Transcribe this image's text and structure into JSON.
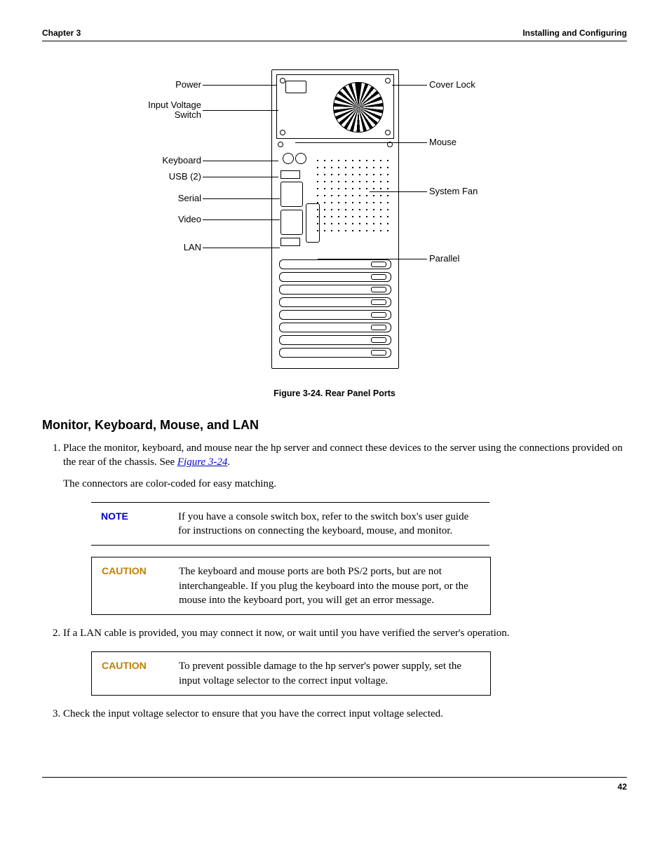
{
  "header": {
    "left": "Chapter 3",
    "right": "Installing and Configuring"
  },
  "figure": {
    "caption": "Figure 3-24.  Rear Panel Ports",
    "labels_left": {
      "power": "Power",
      "input_voltage": "Input Voltage\nSwitch",
      "keyboard": "Keyboard",
      "usb": "USB (2)",
      "serial": "Serial",
      "video": "Video",
      "lan": "LAN"
    },
    "labels_right": {
      "cover_lock": "Cover Lock",
      "mouse": "Mouse",
      "system_fan": "System Fan",
      "parallel": "Parallel"
    }
  },
  "section_heading": "Monitor, Keyboard, Mouse, and LAN",
  "steps": {
    "s1a": "Place the monitor, keyboard, and mouse near the hp server and connect these devices to the server using the connections provided on the rear of the chassis. See ",
    "s1_figref": "Figure 3-24",
    "s1b": ".",
    "s1_extra": "The connectors are color-coded for easy matching.",
    "s2": "If a LAN cable is provided, you may connect it now, or wait until you have verified the server's operation.",
    "s3": "Check the input voltage selector to ensure that you have the correct input voltage selected."
  },
  "note": {
    "label": "NOTE",
    "text": "If you have a console switch box, refer to the switch box's user guide for instructions on connecting the keyboard, mouse, and monitor."
  },
  "caution1": {
    "label": "CAUTION",
    "text": "The keyboard and mouse ports are both PS/2 ports, but are not interchangeable. If you plug the keyboard into the mouse port, or the mouse into the keyboard port, you will get an error message."
  },
  "caution2": {
    "label": "CAUTION",
    "text": "To prevent possible damage to the hp server's power supply, set the input voltage selector to the correct input voltage."
  },
  "page_number": "42"
}
